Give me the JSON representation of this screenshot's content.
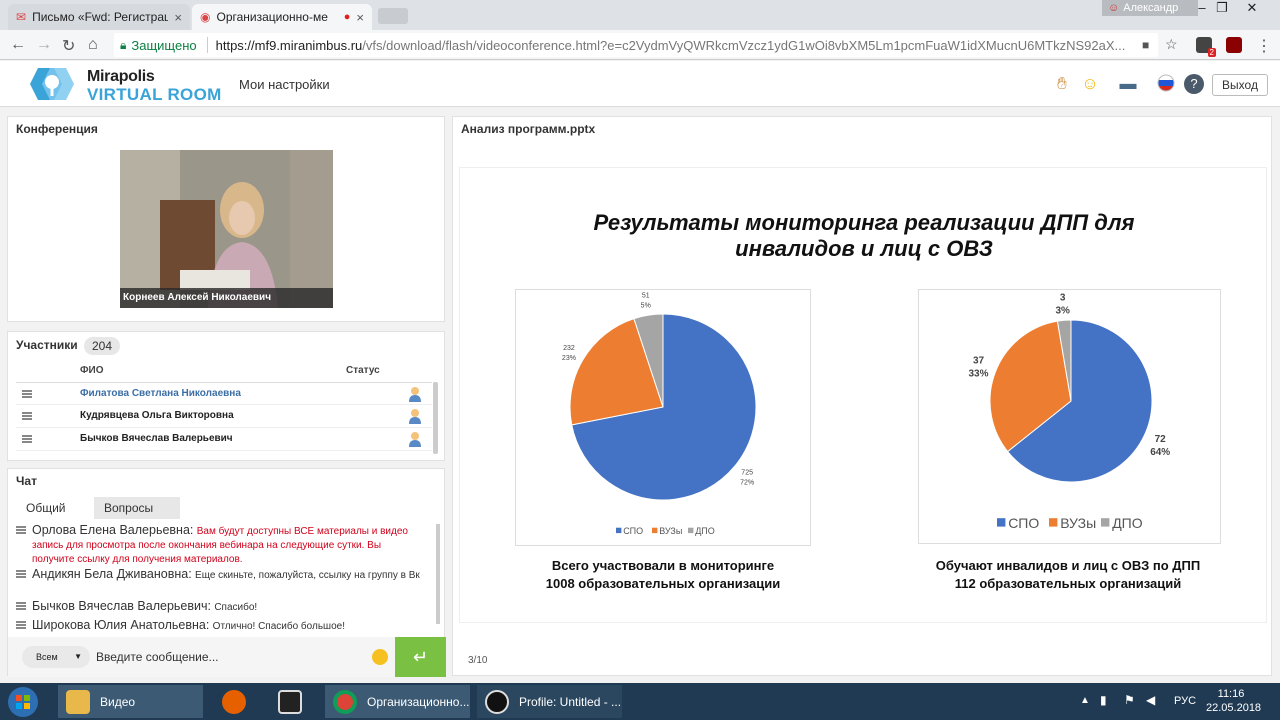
{
  "browser": {
    "tabs": [
      {
        "title": "Письмо «Fwd: Регистрац",
        "close": "×"
      },
      {
        "title": "Организационно-ме",
        "close": "×"
      }
    ],
    "window_user": "Александр",
    "secure_label": "Защищено",
    "url_host": "https://mf9.miranimbus.ru",
    "url_path": "/vfs/download/flash/videoconference.html?e=c2VydmVyQWRkcmVzcz1ydG1wOi8vbXM5Lm1pcmFuaW1idXMucnU6MTkzNS92aX...",
    "ext_badge": "2"
  },
  "app": {
    "brand_line1": "Mirapolis",
    "brand_line2": "VIRTUAL ROOM",
    "my_settings": "Мои настройки",
    "logout": "Выход"
  },
  "conference": {
    "title": "Конференция",
    "speaker": "Корнеев Алексей Николаевич"
  },
  "participants": {
    "title": "Участники",
    "count": "204",
    "col_name": "ФИО",
    "col_status": "Статус",
    "rows": [
      {
        "name": "Филатова Светлана Николаевна"
      },
      {
        "name": "Кудрявцева Ольга Викторовна"
      },
      {
        "name": "Бычков Вячеслав Валерьевич"
      }
    ]
  },
  "chat": {
    "title": "Чат",
    "tab_general": "Общий",
    "tab_questions": "Вопросы",
    "messages": [
      {
        "author": "Орлова Елена Валерьевна:",
        "text": "Вам будут доступны ВСЕ материалы и видео запись для просмотра после окончания вебинара на следующие сутки. Вы получите ссылку для получения материалов."
      },
      {
        "author": "Андикян Бела Дживановна:",
        "text": "Еще скиньте, пожалуйста, ссылку на группу в Вк"
      },
      {
        "author": "Бычков Вячеслав Валерьевич:",
        "text": "Спасибо!"
      },
      {
        "author": "Широкова Юлия Анатольевна:",
        "text": "Отлично! Спасибо большое!"
      }
    ],
    "recipients": "Всем",
    "input_placeholder": "Введите сообщение...",
    "send": "↵"
  },
  "slide": {
    "file": "Анализ программ.pptx",
    "title_line1": "Результаты мониторинга реализации ДПП для",
    "title_line2": "инвалидов и лиц с ОВЗ",
    "caption1_line1": "Всего участвовали в мониторинге",
    "caption1_line2": "1008 образовательных организации",
    "caption2_line1": "Обучают инвалидов и лиц с ОВЗ по ДПП",
    "caption2_line2": "112 образовательных организаций",
    "page": "3/10"
  },
  "chart_data": [
    {
      "type": "pie",
      "categories": [
        "СПО",
        "ВУЗы",
        "ДПО"
      ],
      "values": [
        725,
        232,
        51
      ],
      "percent_labels": [
        "72%",
        "23%",
        "5%"
      ],
      "colors": [
        "#4472c4",
        "#ed7d31",
        "#a5a5a5"
      ],
      "legend": "bottom"
    },
    {
      "type": "pie",
      "categories": [
        "СПО",
        "ВУЗы",
        "ДПО"
      ],
      "values": [
        72,
        37,
        3
      ],
      "percent_labels": [
        "64%",
        "33%",
        "3%"
      ],
      "colors": [
        "#4472c4",
        "#ed7d31",
        "#a5a5a5"
      ],
      "legend": "bottom"
    }
  ],
  "taskbar": {
    "items": [
      "Видео",
      "Организационно...",
      "Profile: Untitled - ..."
    ],
    "lang": "РУС",
    "time": "11:16",
    "date": "22.05.2018"
  }
}
